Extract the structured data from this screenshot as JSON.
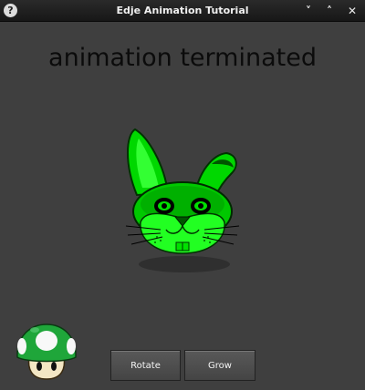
{
  "window": {
    "title": "Edje Animation Tutorial",
    "help_glyph": "?",
    "minimize_glyph": "˅",
    "maximize_glyph": "˄",
    "close_glyph": "✕"
  },
  "status": {
    "text": "animation terminated"
  },
  "buttons": {
    "rotate_label": "Rotate",
    "grow_label": "Grow"
  },
  "icons": {
    "rabbit": "rabbit-icon",
    "mushroom": "mushroom-icon"
  },
  "colors": {
    "rabbit_green": "#00e000",
    "background": "#3f3f3f",
    "mushroom_green": "#1fa63a"
  }
}
